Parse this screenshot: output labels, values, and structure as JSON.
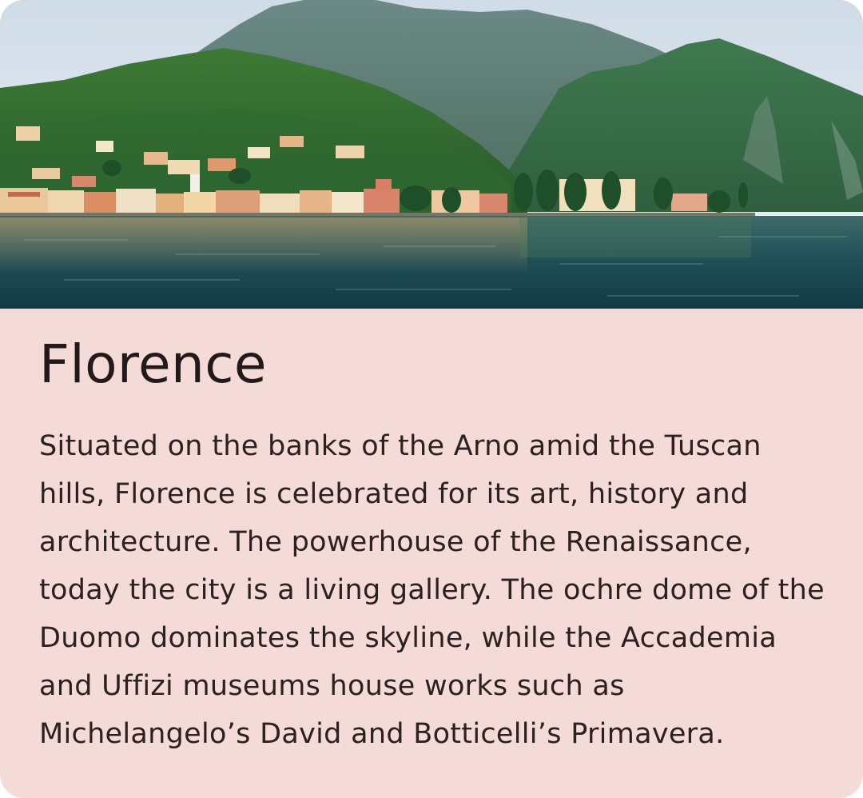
{
  "card": {
    "title": "Florence",
    "description": "Situated on the banks of the Arno amid the Tuscan hills, Florence is celebrated for its art, history and architecture. The powerhouse of the Renaissance, today the city is a living gallery. The ochre dome of the Duomo dominates the skyline, while the Accademia and Uffizi museums house works such as Michelangelo’s David and Botticelli’s Primavera.",
    "colors": {
      "background": "#f5dbd8",
      "text": "#211a19"
    }
  }
}
